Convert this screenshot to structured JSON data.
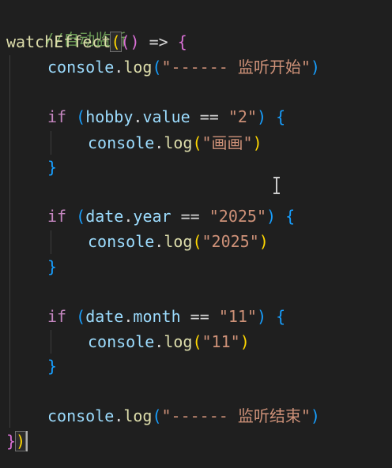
{
  "editor": {
    "comment": "//自动监听",
    "watch_fn": "watchEffect",
    "arrow": "=>",
    "console": "console",
    "log": "log",
    "log_start": "\"------ 监听开始\"",
    "if_kw": "if",
    "hobby_obj": "hobby",
    "hobby_prop": "value",
    "eq": "==",
    "hobby_cmp": "\"2\"",
    "log_hobby": "\"画画\"",
    "date_obj": "date",
    "year_prop": "year",
    "year_cmp": "\"2025\"",
    "log_year": "\"2025\"",
    "month_prop": "month",
    "month_cmp": "\"11\"",
    "log_month": "\"11\"",
    "log_end": "\"------ 监听结束\""
  },
  "colors": {
    "background": "#1f1f1f",
    "comment": "#6a9955",
    "function": "#dcdcaa",
    "identifier": "#9cdcfe",
    "keyword": "#c586c0",
    "string": "#ce9178",
    "bracket_level1": "#ffd700",
    "bracket_level2": "#da70d6",
    "bracket_level3": "#179fff"
  },
  "icons": {
    "mouse_cursor": "text-ibeam-cursor-icon"
  }
}
